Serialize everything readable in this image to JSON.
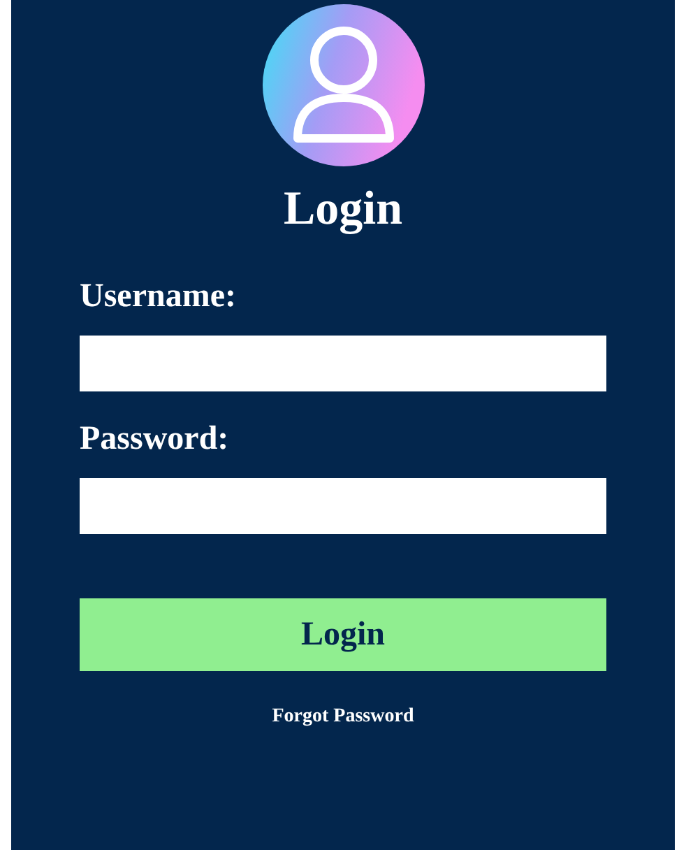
{
  "title": "Login",
  "fields": [
    {
      "label": "Username:"
    },
    {
      "label": "Password:"
    }
  ],
  "button": "Login",
  "link": "Forgot Password"
}
